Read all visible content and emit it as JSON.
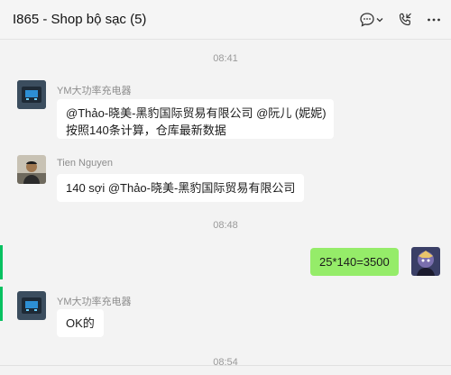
{
  "header": {
    "title": "I865 - Shop bộ sạc (5)",
    "icons": [
      "chat-icon",
      "chevron-down-icon",
      "call-icon",
      "more-icon"
    ]
  },
  "messages": {
    "t1": "08:41",
    "m1": {
      "sender": "YM大功率充电器",
      "line1": "@Thảo-晓美-黑豹国际贸易有限公司 @阮儿 (妮妮)",
      "line2": "按照140条计算，仓库最新数据"
    },
    "m2": {
      "sender": "Tien Nguyen",
      "text": "140 sợi @Thảo-晓美-黑豹国际贸易有限公司"
    },
    "t2": "08:48",
    "m3": {
      "text": "25*140=3500"
    },
    "m4": {
      "sender": "YM大功率充电器",
      "text": "OK的"
    },
    "t3": "08:54"
  },
  "colors": {
    "mine_bubble": "#95ec69",
    "other_bubble": "#ffffff",
    "background": "#f3f3f3",
    "accent": "#07c160"
  }
}
